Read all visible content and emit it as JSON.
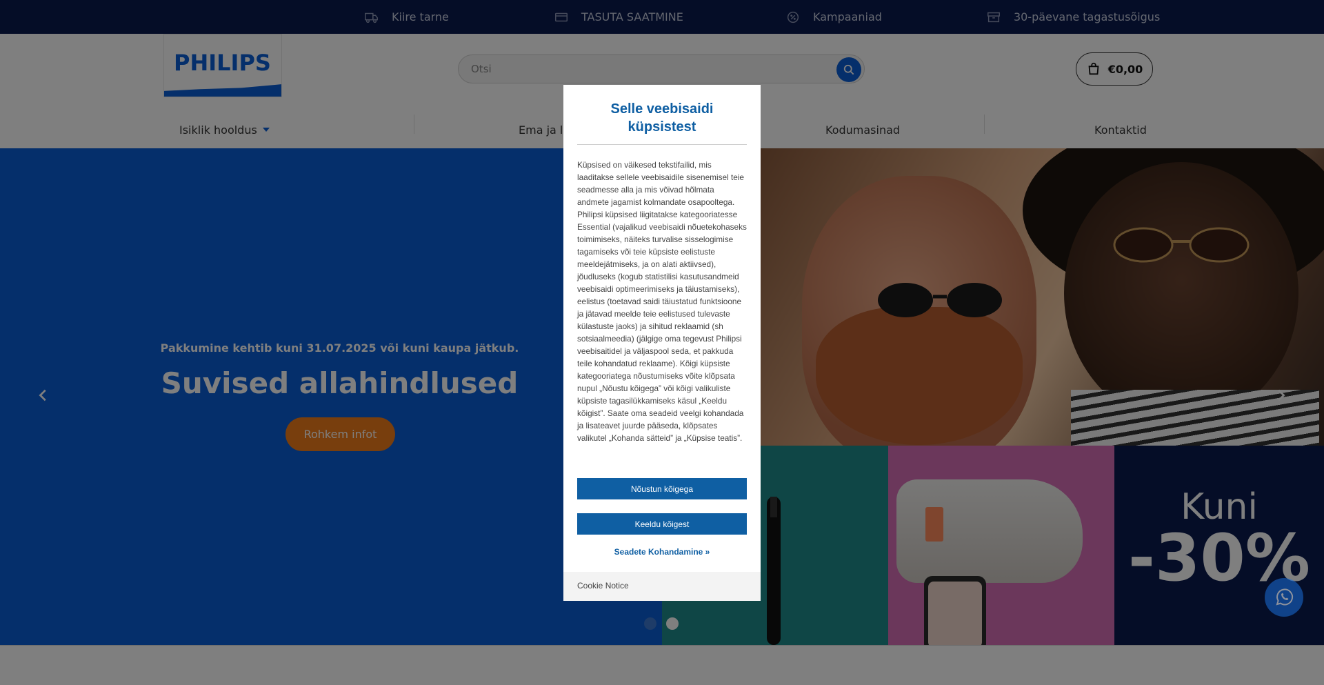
{
  "topbar": {
    "items": [
      {
        "label": "Kiire tarne",
        "icon": "truck-icon"
      },
      {
        "label": "TASUTA SAATMINE",
        "icon": "card-icon"
      },
      {
        "label": "Kampaaniad",
        "icon": "discount-badge-icon"
      },
      {
        "label": "30-päevane tagastusõigus",
        "icon": "box-icon"
      }
    ]
  },
  "header": {
    "logo_text": "PHILIPS",
    "search_placeholder": "Otsi",
    "cart_total": "€0,00"
  },
  "nav": {
    "items": [
      "Isiklik hooldus",
      "Ema ja la",
      "Kodumasinad",
      "Kontaktid"
    ]
  },
  "hero": {
    "subtitle": "Pakkumine kehtib kuni 31.07.2025 või kuni kaupa jätkub.",
    "title": "Suvised allahindlused",
    "button": "Rohkem infot",
    "promo_line1": "Kuni",
    "promo_line2": "-30%",
    "active_slide": 2,
    "slide_count": 2
  },
  "cookie_modal": {
    "title": "Selle veebisaidi küpsistest",
    "body": "Küpsised on väikesed tekstifailid, mis laaditakse sellele veebisaidile sisenemisel teie seadmesse alla ja mis võivad hõlmata andmete jagamist kolmandate osapooltega. Philipsi küpsised liigitatakse kategooriatesse Essential (vajalikud veebisaidi nõuetekohaseks toimimiseks, näiteks turvalise sisselogimise tagamiseks või teie küpsiste eelistuste meeldejätmiseks, ja on alati aktiivsed), jõudluseks (kogub statistilisi kasutusandmeid veebisaidi optimeerimiseks ja täiustamiseks), eelistus (toetavad saidi täiustatud funktsioone ja jätavad meelde teie eelistused tulevaste külastuste jaoks) ja sihitud reklaamid (sh sotsiaalmeedia) (jälgige oma tegevust Philipsi veebisaitidel ja väljaspool seda, et pakkuda teile kohandatud reklaame). Kõigi küpsiste kategooriatega nõustumiseks võite klõpsata nupul „Nõustu kõigega” või kõigi valikuliste küpsiste tagasilükkamiseks käsul „Keeldu kõigist”. Saate oma seadeid veelgi kohandada ja lisateavet juurde pääseda, klõpsates valikutel „Kohanda sätteid” ja „Küpsise teatis”.",
    "accept_button": "Nõustun kõigega",
    "reject_button": "Keeldu kõigest",
    "settings_link": "Seadete Kohandamine »",
    "footer_link": "Cookie Notice"
  },
  "colors": {
    "topbar_bg": "#0b1a4e",
    "brand_blue": "#0b5ed7",
    "modal_blue": "#0f5fa3",
    "cta_orange": "#f07c1a"
  }
}
